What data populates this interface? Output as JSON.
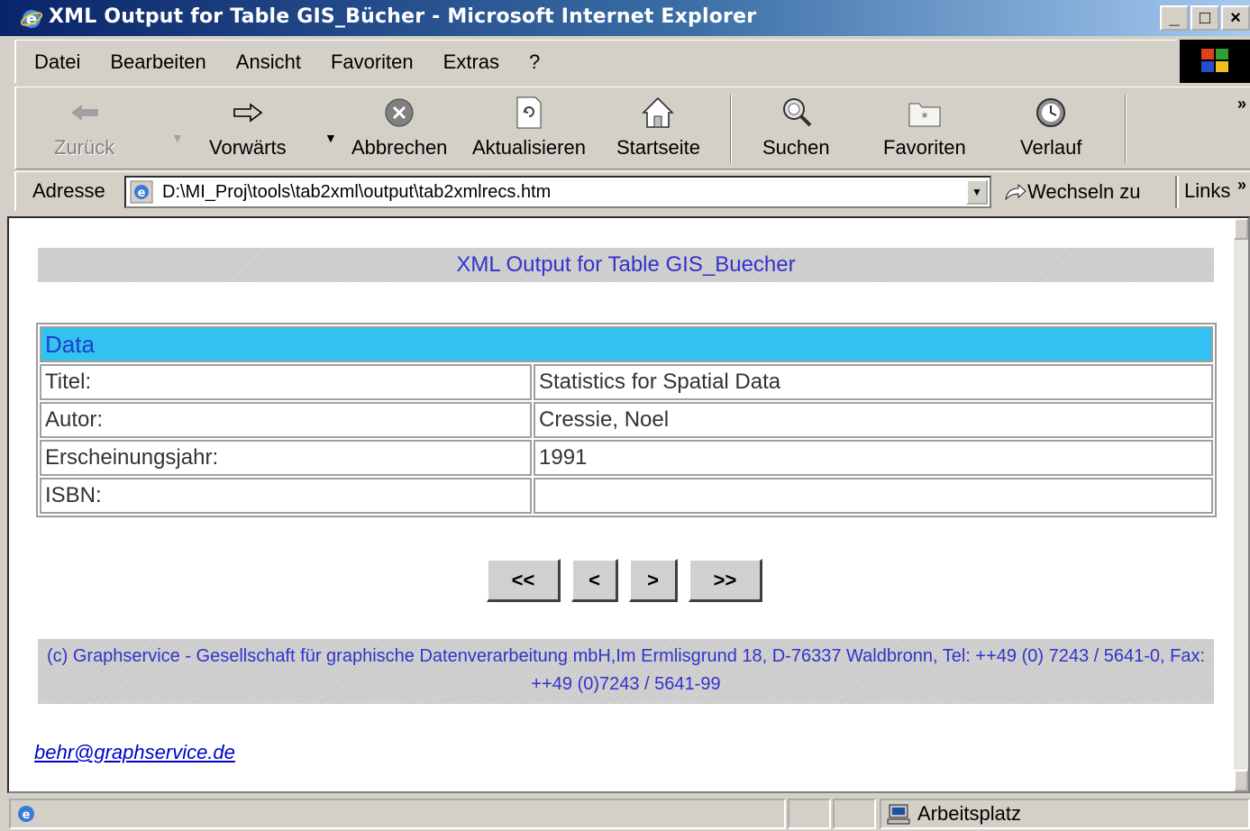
{
  "window": {
    "title": "XML Output for Table GIS_Bücher - Microsoft Internet Explorer",
    "buttons": {
      "minimize": "_",
      "maximize": "□",
      "close": "×"
    }
  },
  "menu": {
    "items": [
      "Datei",
      "Bearbeiten",
      "Ansicht",
      "Favoriten",
      "Extras",
      "?"
    ]
  },
  "toolbar": {
    "back": "Zurück",
    "forward": "Vorwärts",
    "stop": "Abbrechen",
    "refresh": "Aktualisieren",
    "home": "Startseite",
    "search": "Suchen",
    "favorites": "Favoriten",
    "history": "Verlauf"
  },
  "address": {
    "label": "Adresse",
    "url": "D:\\MI_Proj\\tools\\tab2xml\\output\\tab2xmlrecs.htm",
    "go": "Wechseln zu",
    "links": "Links"
  },
  "page": {
    "header": "XML Output for Table GIS_Buecher",
    "table": {
      "heading": "Data",
      "rows": [
        {
          "label": "Titel:",
          "value": "Statistics for Spatial Data"
        },
        {
          "label": "Autor:",
          "value": "Cressie, Noel"
        },
        {
          "label": "Erscheinungsjahr:",
          "value": "1991"
        },
        {
          "label": "ISBN:",
          "value": ""
        }
      ]
    },
    "nav": {
      "first": "<<",
      "prev": "<",
      "next": ">",
      "last": ">>"
    },
    "footer": "(c) Graphservice - Gesellschaft für graphische Datenverarbeitung mbH,Im Ermlisgrund 18, D-76337 Waldbronn, Tel: ++49 (0) 7243 / 5641-0, Fax: ++49 (0)7243 / 5641-99",
    "email": "behr@graphservice.de"
  },
  "status": {
    "zone": "Arbeitsplatz"
  },
  "colors": {
    "title_bar": "#0a246a",
    "table_head": "#33c3f3",
    "link_text": "#3333cc"
  }
}
